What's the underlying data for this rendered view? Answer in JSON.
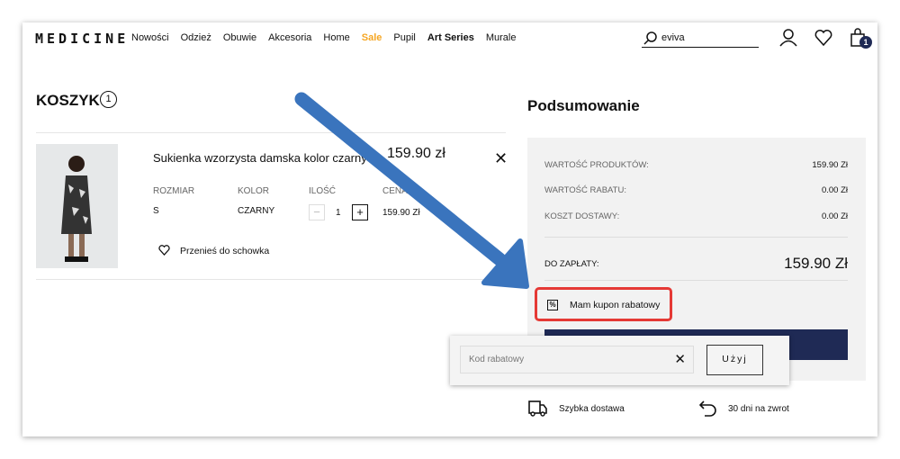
{
  "header": {
    "logo": "MEDICINE",
    "nav": [
      "Nowości",
      "Odzież",
      "Obuwie",
      "Akcesoria",
      "Home",
      "Sale",
      "Pupil",
      "Art Series",
      "Murale"
    ],
    "search_value": "eviva",
    "cart_count": "1"
  },
  "cart": {
    "title": "KOSZYK",
    "count": "1",
    "item": {
      "name": "Sukienka wzorzysta damska kolor czarny",
      "price": "159.90 zł",
      "labels": {
        "size": "ROZMIAR",
        "color": "KOLOR",
        "qty": "ILOŚĆ",
        "price": "CENA"
      },
      "size": "S",
      "color": "CZARNY",
      "qty": "1",
      "unit_price": "159.90 Zł",
      "move": "Przenieś do schowka"
    }
  },
  "summary": {
    "title": "Podsumowanie",
    "rows": [
      {
        "label": "WARTOŚĆ PRODUKTÓW:",
        "value": "159.90 Zł"
      },
      {
        "label": "WARTOŚĆ RABATU:",
        "value": "0.00 Zł"
      },
      {
        "label": "KOSZT DOSTAWY:",
        "value": "0.00 Zł"
      }
    ],
    "total_label": "DO ZAPŁATY:",
    "total": "159.90 Zł",
    "coupon": "Mam kupon rabatowy"
  },
  "coupon_popup": {
    "placeholder": "Kod rabatowy",
    "apply": "Użyj"
  },
  "perks": {
    "delivery": "Szybka dostawa",
    "returns": "30 dni na zwrot"
  },
  "colors": {
    "sale": "#f5a623",
    "arrow": "#3a74bd",
    "navy": "#1f2a55",
    "highlight": "#e53935"
  }
}
